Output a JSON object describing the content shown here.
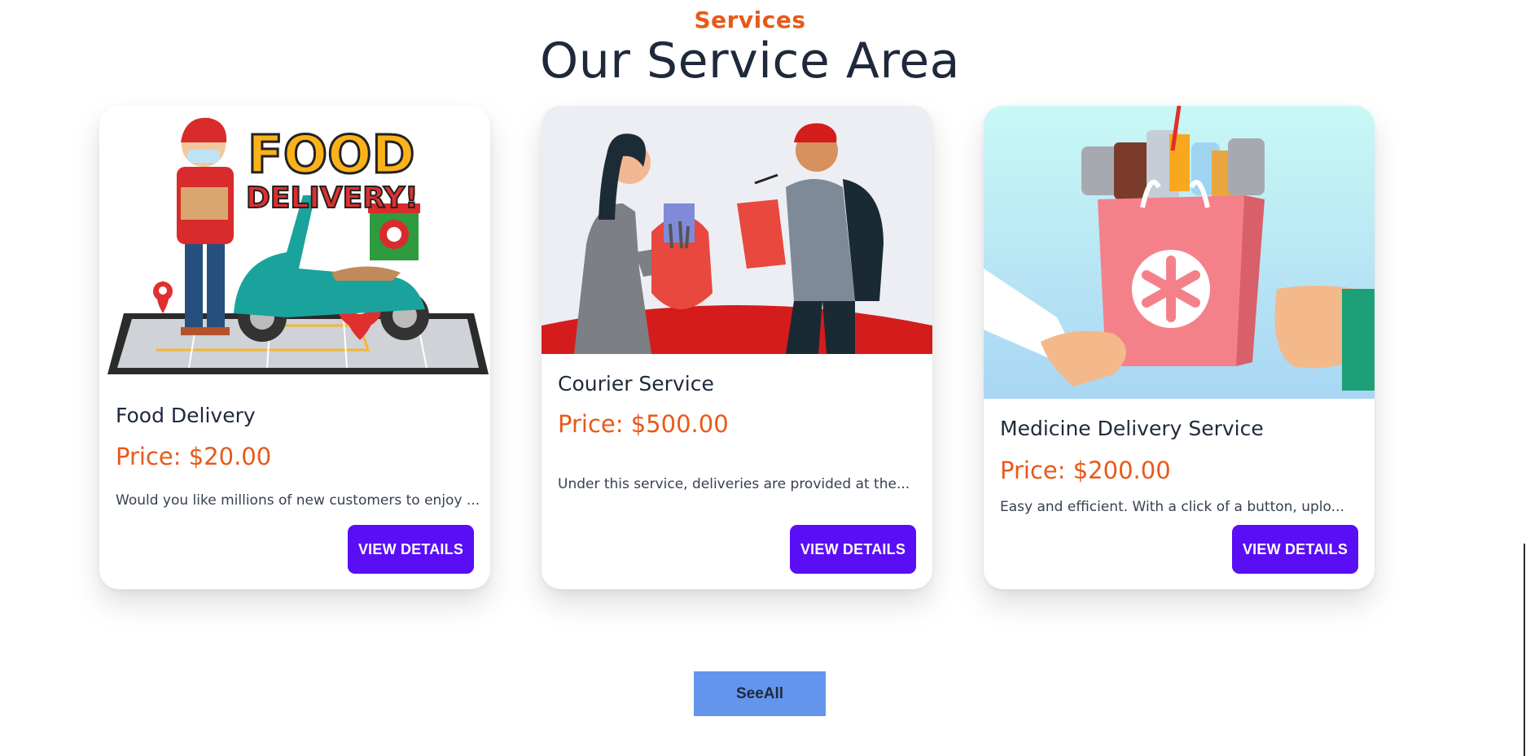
{
  "section": {
    "eyebrow": "Services",
    "title": "Our Service Area"
  },
  "cards": [
    {
      "name": "Food Delivery",
      "price": "Price: $20.00",
      "description": "Would you like millions of new customers to enjoy ...",
      "button_label": "VIEW DETAILS",
      "image": {
        "icon": "food-delivery-illustration",
        "banner_text_1": "FOOD",
        "banner_text_2": "DELIVERY!"
      }
    },
    {
      "name": "Courier Service",
      "price": "Price: $500.00",
      "description": "Under this service, deliveries are provided at the...",
      "button_label": "VIEW DETAILS",
      "image": {
        "icon": "courier-service-illustration"
      }
    },
    {
      "name": "Medicine Delivery Service",
      "price": "Price: $200.00",
      "description": "Easy and efficient. With a click of a button, uplo...",
      "button_label": "VIEW DETAILS",
      "image": {
        "icon": "medicine-delivery-illustration"
      }
    }
  ],
  "see_all_label": "SeeAll",
  "colors": {
    "accent_orange": "#e8591a",
    "button_purple": "#5a0ef5",
    "see_all_blue": "#6495ed",
    "title_dark": "#1e293b"
  }
}
